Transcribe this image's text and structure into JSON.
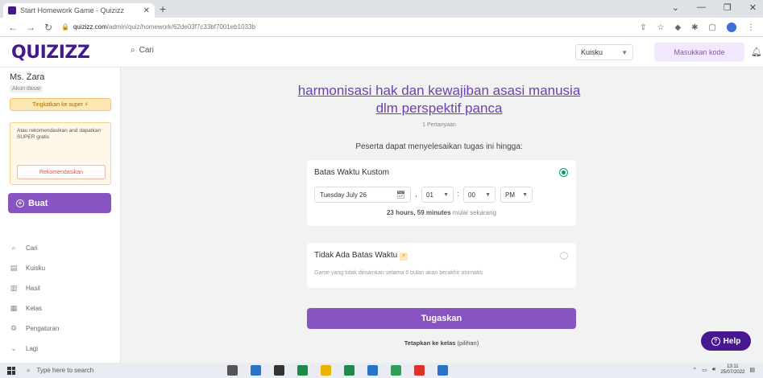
{
  "browser": {
    "tab_title": "Start Homework Game - Quizizz",
    "tab_close": "✕",
    "new_tab": "+",
    "url_host": "quizizz.com",
    "url_path": "/admin/quiz/homework/62de03f7c33bf7001eb1033b",
    "controls": [
      "⌄",
      "—",
      "❐",
      "✕"
    ]
  },
  "header": {
    "logo": "QUIZIZZ",
    "search_placeholder": "Cari",
    "library_select": "Kuisku",
    "join_button": "Masukkan kode"
  },
  "sidebar": {
    "user_name": "Ms. Zara",
    "user_role": "Akun dasar",
    "upgrade_label": "Tingkatkan ke super",
    "promo_text": "Atau rekomendasikan and dapatkan SUPER gratis",
    "promo_button": "Rekomendasikan",
    "create_label": "Buat",
    "nav": [
      {
        "label": "Cari",
        "icon": "search-icon"
      },
      {
        "label": "Kuisku",
        "icon": "library-icon"
      },
      {
        "label": "Hasil",
        "icon": "reports-icon"
      },
      {
        "label": "Kelas",
        "icon": "classes-icon"
      },
      {
        "label": "Pengaturan",
        "icon": "settings-icon"
      },
      {
        "label": "Lagi",
        "icon": "more-icon"
      }
    ]
  },
  "main": {
    "quiz_title": "harmonisasi hak dan kewajiban asasi manusia dlm perspektif panca",
    "question_count": "1 Pertanyaan",
    "deadline_prompt": "Peserta dapat menyelesaikan tugas ini hingga:",
    "custom_deadline": {
      "title": "Batas Waktu Kustom",
      "date": "Tuesday July 26",
      "hour": "01",
      "minute": "00",
      "ampm": "PM",
      "remaining_bold": "23 hours, 59 minutes",
      "remaining_rest": "mulai sekarang"
    },
    "no_deadline": {
      "title": "Tidak Ada Batas Waktu",
      "note": "Game yang tidak dimainkan selama 6 bulan akan berakhir otomatis"
    },
    "assign_button": "Tugaskan",
    "class_bold": "Tetapkan ke kelas",
    "class_rest": "(pilihan)",
    "help": "Help"
  },
  "taskbar": {
    "search_placeholder": "Type here to search",
    "time": "13:11",
    "date": "25/07/2022",
    "app_colors": [
      "#555555",
      "#2b73c9",
      "#333333",
      "#1c8b4a",
      "#e8b400",
      "#1c8b4a",
      "#2b73c9",
      "#2e9e58",
      "#d9332c",
      "#2b73c9"
    ]
  }
}
